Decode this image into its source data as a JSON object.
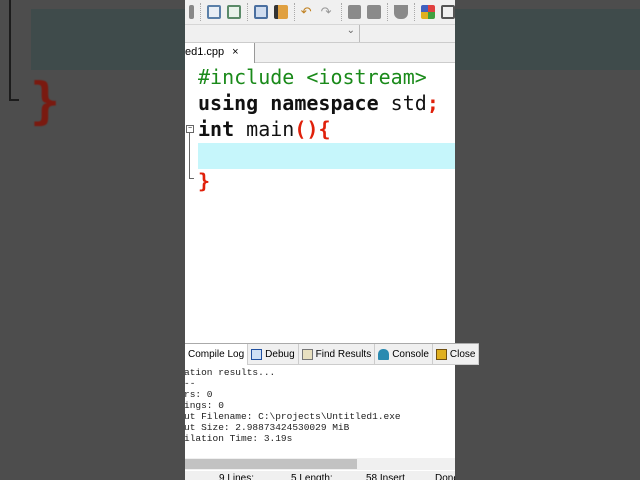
{
  "editor_tab": {
    "filename": "ed1.cpp",
    "close": "×"
  },
  "code": {
    "line1": "#include <iostream>",
    "line2_kw1": "using",
    "line2_kw2": "namespace",
    "line2_rest": " std",
    "line2_semi": ";",
    "line3_kw": "int",
    "line3_name": " main",
    "line3_paren": "()",
    "line3_brace": "{",
    "line5_brace": "}"
  },
  "background": {
    "brace": "}"
  },
  "bottom_tabs": [
    {
      "label": "Compile Log"
    },
    {
      "label": "Debug"
    },
    {
      "label": "Find Results"
    },
    {
      "label": "Console"
    },
    {
      "label": "Close"
    }
  ],
  "log_lines": [
    "ation results...",
    "--",
    "rs: 0",
    "ings: 0",
    "ut Filename: C:\\projects\\Untitled1.exe",
    "ut Size: 2.98873424530029 MiB",
    "ilation Time: 3.19s"
  ],
  "status": {
    "lines": "9 Lines:",
    "length": "5 Length:",
    "insert": "58 Insert",
    "done": "Done"
  },
  "combo": {
    "chevron": "⌄"
  }
}
